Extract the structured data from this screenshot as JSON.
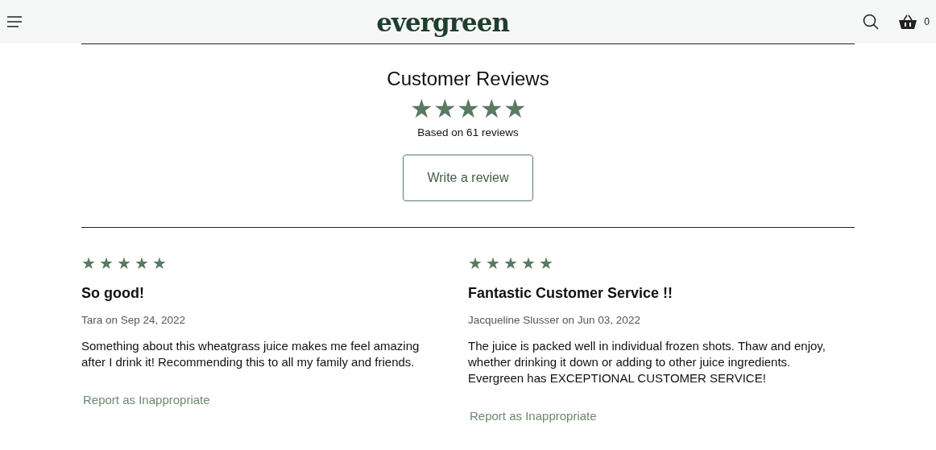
{
  "header": {
    "logo": "evergreen",
    "cart_count": "0"
  },
  "summary": {
    "title": "Customer Reviews",
    "stars": 5,
    "based_on": "Based on 61 reviews",
    "write_button": "Write a review"
  },
  "reviews": [
    {
      "stars": 5,
      "title": "So good!",
      "byline": "Tara on Sep 24, 2022",
      "body": "Something about this wheatgrass juice makes me feel amazing after I drink it! Recommending this to all my family and friends.",
      "report": "Report as Inappropriate"
    },
    {
      "stars": 5,
      "title": "Fantastic Customer Service !!",
      "byline": "Jacqueline Slusser on Jun 03, 2022",
      "body": "The juice is packed well in individual frozen shots. Thaw and enjoy, whether drinking it down or adding to other juice ingredients. Evergreen has EXCEPTIONAL CUSTOMER SERVICE!",
      "report": "Report as Inappropriate"
    }
  ]
}
